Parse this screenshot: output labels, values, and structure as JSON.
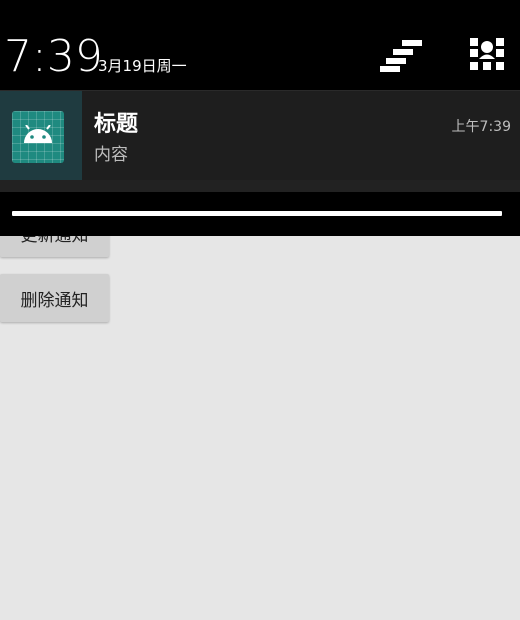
{
  "app": {
    "update_button": "更新通知",
    "delete_button": "删除通知"
  },
  "status": {
    "clock": "7:39",
    "date": "3月19日周一"
  },
  "notification": {
    "title": "标题",
    "content": "内容",
    "time": "上午7:39",
    "icon": "android-icon",
    "icon_color": "#1f8a80"
  },
  "icons": {
    "settings": "settings-bars-icon",
    "quick_settings": "quick-settings-user-icon"
  }
}
